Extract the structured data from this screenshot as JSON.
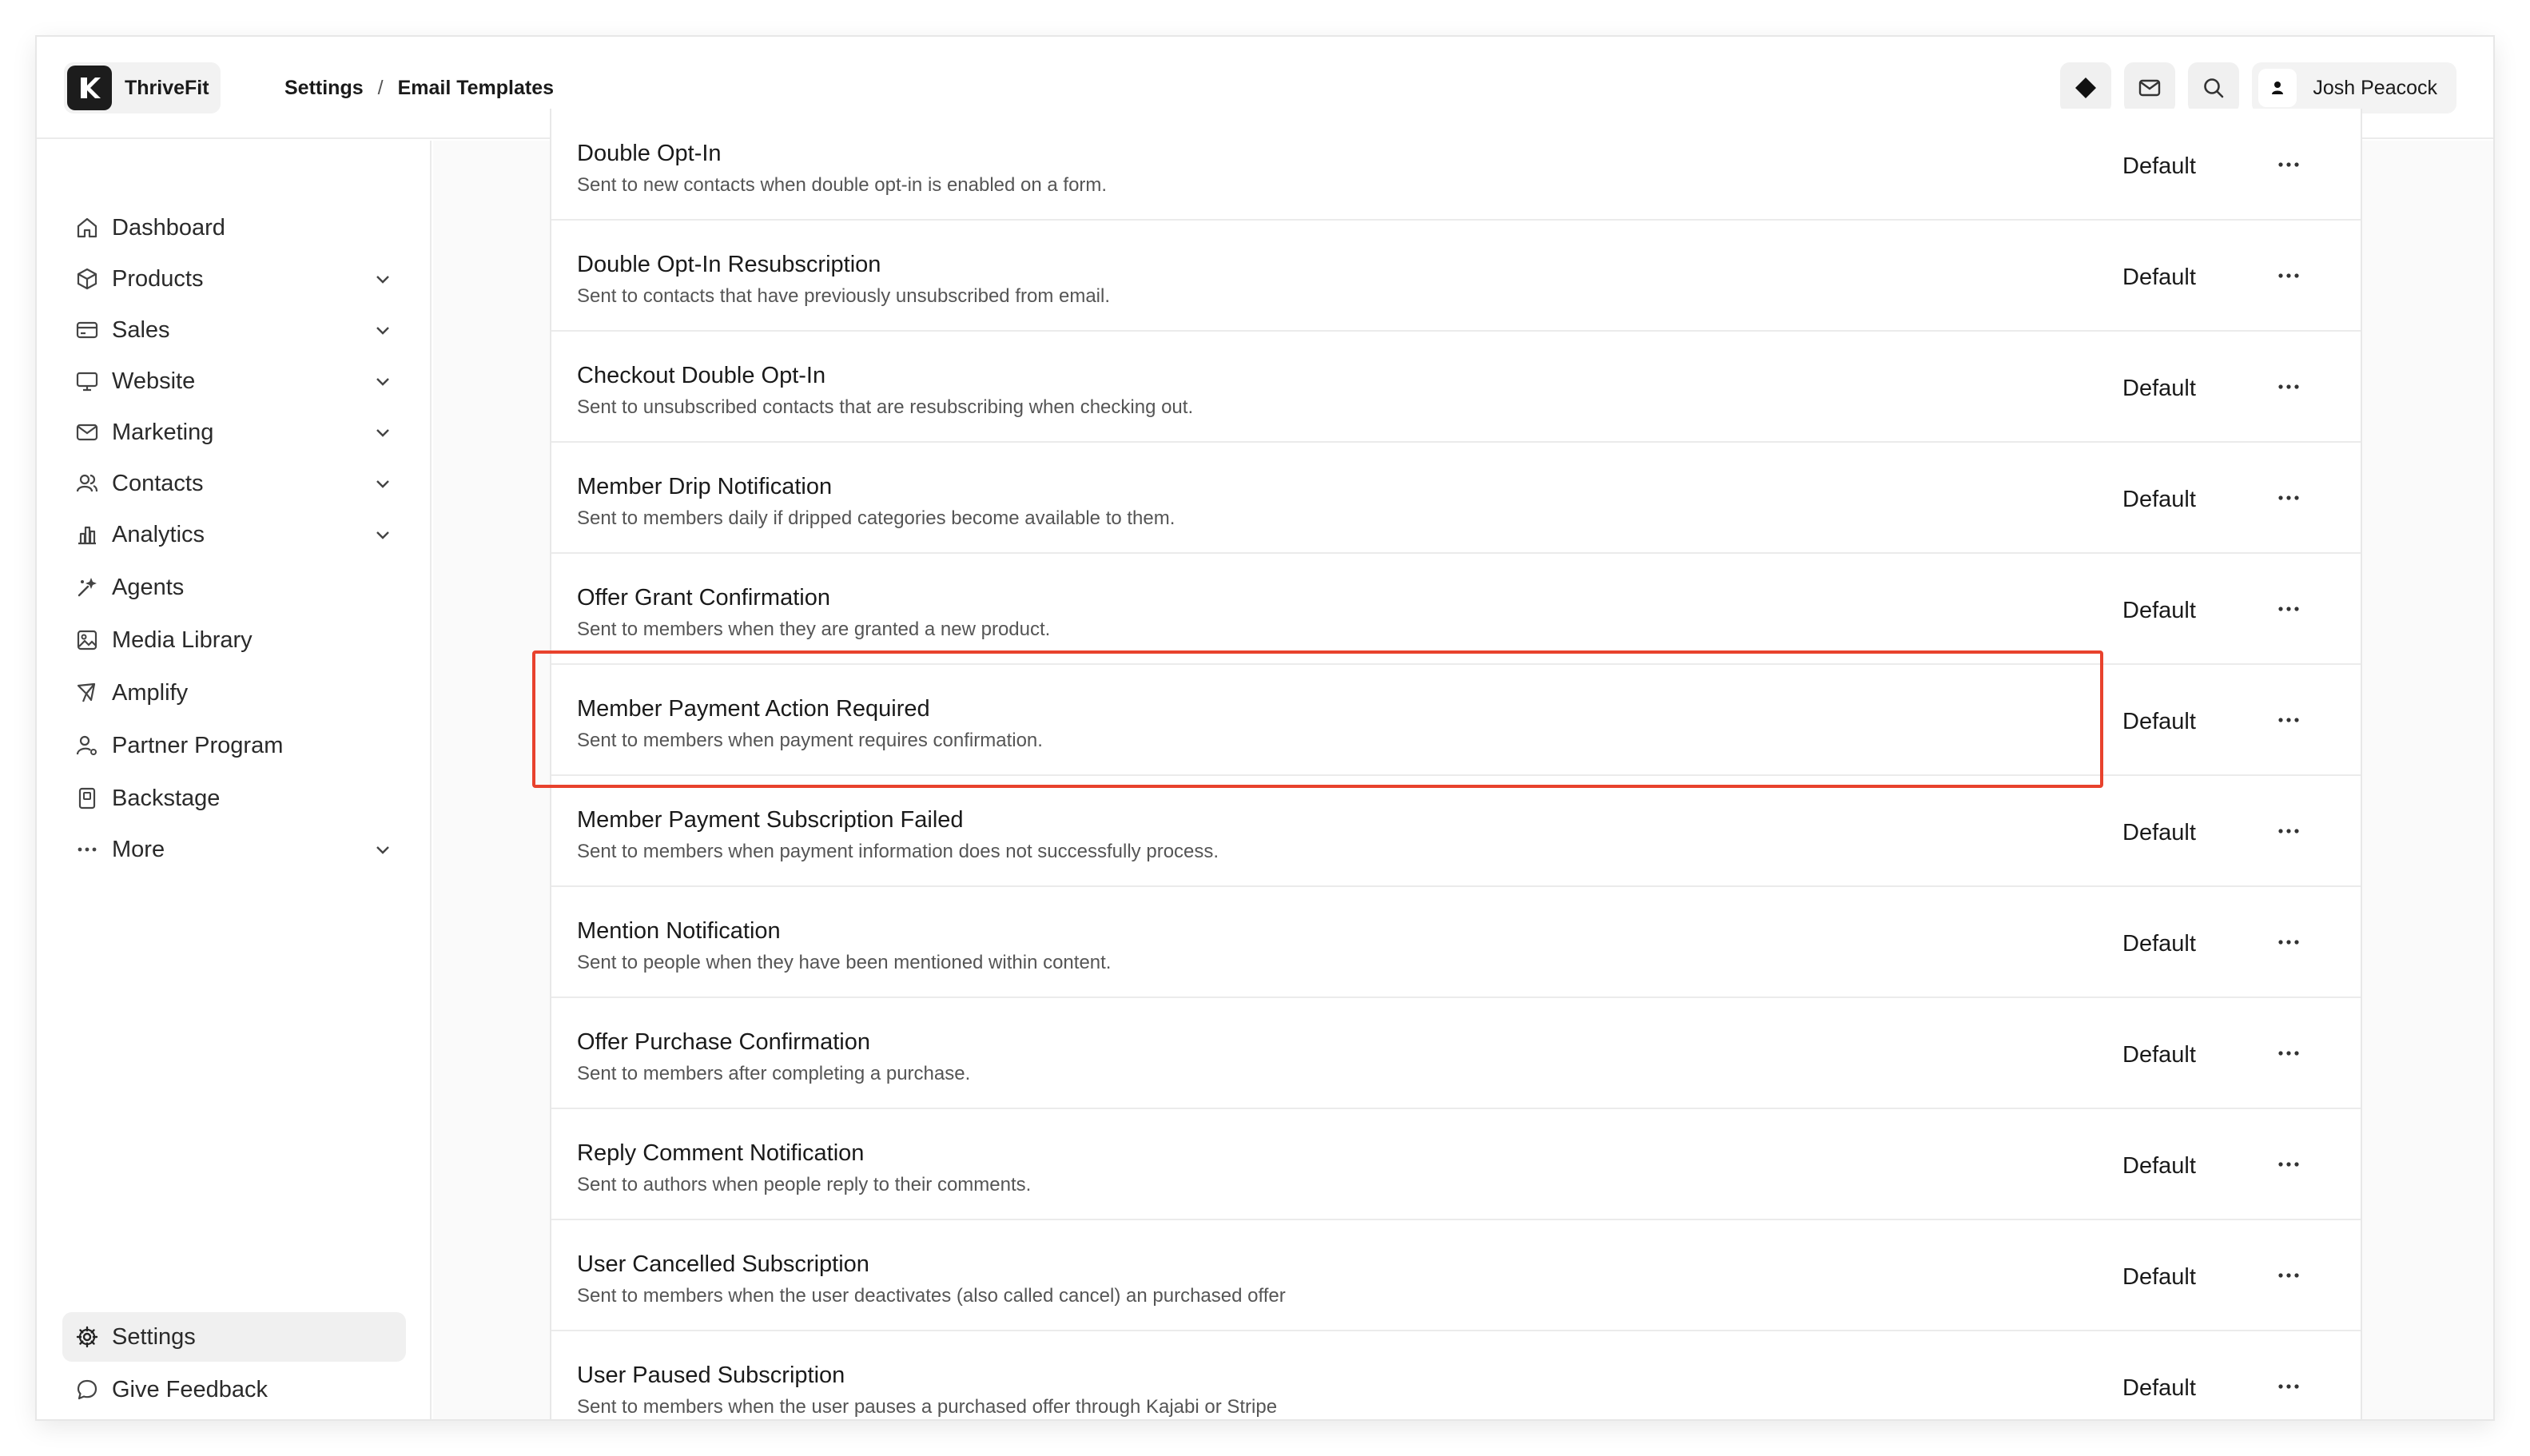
{
  "app": {
    "brand": "ThriveFit"
  },
  "breadcrumb": {
    "parent": "Settings",
    "separator": "/",
    "current": "Email Templates"
  },
  "header": {
    "user_name": "Josh Peacock"
  },
  "sidebar": {
    "items": [
      {
        "label": "Dashboard",
        "icon": "home-icon"
      },
      {
        "label": "Products",
        "icon": "box-icon"
      },
      {
        "label": "Sales",
        "icon": "credit-card-icon"
      },
      {
        "label": "Website",
        "icon": "monitor-icon"
      },
      {
        "label": "Marketing",
        "icon": "mail-icon"
      },
      {
        "label": "Contacts",
        "icon": "users-icon"
      },
      {
        "label": "Analytics",
        "icon": "bar-chart-icon"
      },
      {
        "label": "Agents",
        "icon": "sparkle-icon"
      },
      {
        "label": "Media Library",
        "icon": "image-icon"
      },
      {
        "label": "Amplify",
        "icon": "megaphone-icon"
      },
      {
        "label": "Partner Program",
        "icon": "user-cog-icon"
      },
      {
        "label": "Backstage",
        "icon": "backstage-icon"
      },
      {
        "label": "More",
        "icon": "dots-icon"
      }
    ],
    "footer": [
      {
        "label": "Settings",
        "icon": "gear-icon"
      },
      {
        "label": "Give Feedback",
        "icon": "chat-bubble-icon"
      }
    ]
  },
  "templates": [
    {
      "title": "Double Opt-In",
      "description": "Sent to new contacts when double opt-in is enabled on a form.",
      "status": "Default"
    },
    {
      "title": "Double Opt-In Resubscription",
      "description": "Sent to contacts that have previously unsubscribed from email.",
      "status": "Default"
    },
    {
      "title": "Checkout Double Opt-In",
      "description": "Sent to unsubscribed contacts that are resubscribing when checking out.",
      "status": "Default"
    },
    {
      "title": "Member Drip Notification",
      "description": "Sent to members daily if dripped categories become available to them.",
      "status": "Default"
    },
    {
      "title": "Offer Grant Confirmation",
      "description": "Sent to members when they are granted a new product.",
      "status": "Default"
    },
    {
      "title": "Member Payment Action Required",
      "description": "Sent to members when payment requires confirmation.",
      "status": "Default"
    },
    {
      "title": "Member Payment Subscription Failed",
      "description": "Sent to members when payment information does not successfully process.",
      "status": "Default"
    },
    {
      "title": "Mention Notification",
      "description": "Sent to people when they have been mentioned within content.",
      "status": "Default"
    },
    {
      "title": "Offer Purchase Confirmation",
      "description": "Sent to members after completing a purchase.",
      "status": "Default"
    },
    {
      "title": "Reply Comment Notification",
      "description": "Sent to authors when people reply to their comments.",
      "status": "Default"
    },
    {
      "title": "User Cancelled Subscription",
      "description": "Sent to members when the user deactivates (also called cancel) an purchased offer",
      "status": "Default"
    },
    {
      "title": "User Paused Subscription",
      "description": "Sent to members when the user pauses a purchased offer through Kajabi or Stripe",
      "status": "Default"
    }
  ],
  "colors": {
    "highlight": "#e8422d",
    "active_nav_bg": "#f0f0f0"
  }
}
